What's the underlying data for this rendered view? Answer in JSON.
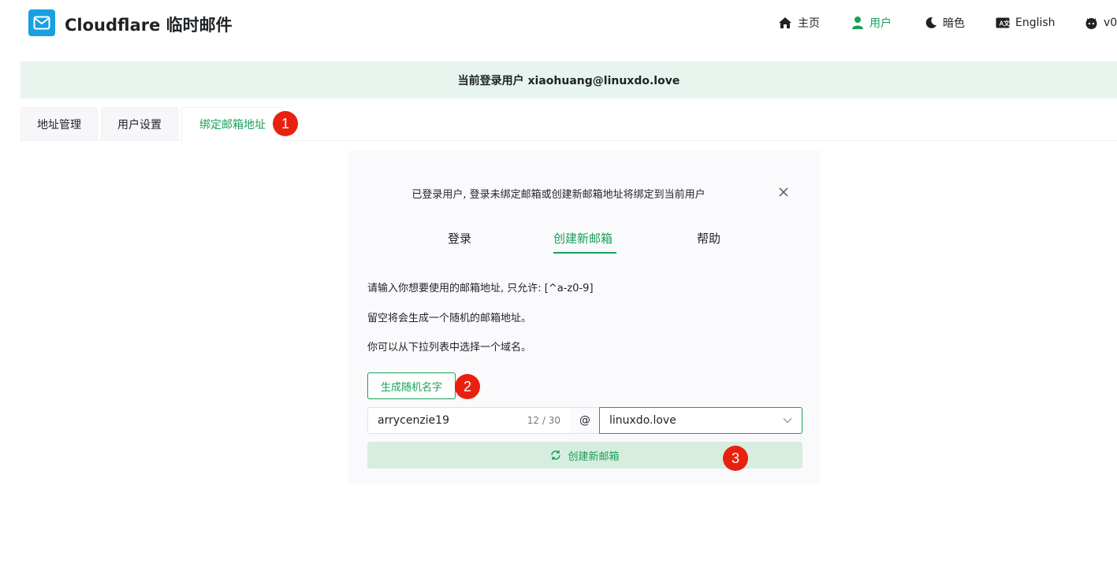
{
  "header": {
    "title": "Cloudflare 临时邮件",
    "nav": {
      "home": "主页",
      "user": "用户",
      "dark": "暗色",
      "language": "English",
      "version": "v0."
    }
  },
  "banner": {
    "text": "当前登录用户 xiaohuang@linuxdo.love"
  },
  "tabs": [
    {
      "label": "地址管理"
    },
    {
      "label": "用户设置"
    },
    {
      "label": "绑定邮箱地址"
    }
  ],
  "markers": [
    "1",
    "2",
    "3"
  ],
  "card": {
    "title": "已登录用户, 登录未绑定邮箱或创建新邮箱地址将绑定到当前用户",
    "subtabs": [
      {
        "label": "登录"
      },
      {
        "label": "创建新邮箱"
      },
      {
        "label": "帮助"
      }
    ],
    "descriptions": [
      "请输入你想要使用的邮箱地址, 只允许: [^a-z0-9]",
      "留空将会生成一个随机的邮箱地址。",
      "你可以从下拉列表中选择一个域名。"
    ],
    "random_button": "生成随机名字",
    "name_value": "arrycenzie19",
    "name_count": "12 / 30",
    "at": "@",
    "domain_value": "linuxdo.love",
    "create_button": "创建新邮箱"
  },
  "colors": {
    "accent": "#18a058",
    "logo": "#18a0e0",
    "marker": "#e8210f",
    "banner_bg": "#e8f5ee"
  }
}
